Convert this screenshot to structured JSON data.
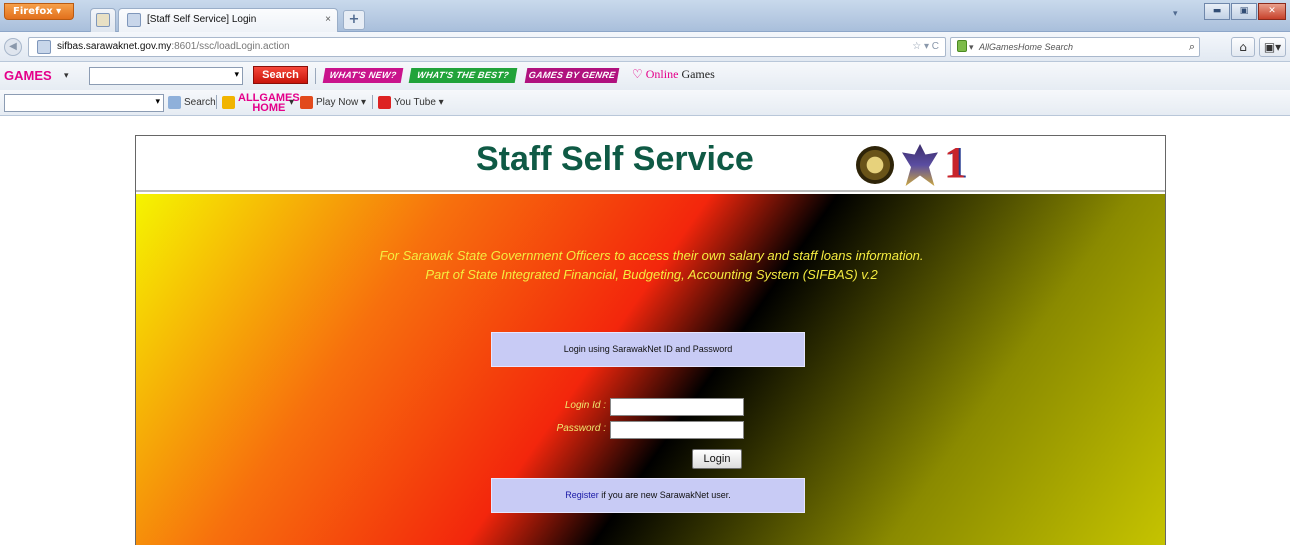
{
  "browser": {
    "menu_button": "Firefox",
    "tab_title": "[Staff Self Service] Login",
    "tab_close": "×",
    "new_tab": "+",
    "url_host": "sifbas.sarawaknet.gov.my",
    "url_rest": ":8601/ssc/loadLogin.action",
    "search_placeholder": "AllGamesHome Search"
  },
  "games_toolbar": {
    "logo": "GAMES",
    "search_button": "Search",
    "whats_new": "WHAT'S NEW?",
    "whats_best": "WHAT'S THE BEST?",
    "games_by_genre": "GAMES BY GENRE",
    "online_prefix": "Online",
    "online_suffix": " Games"
  },
  "toolbar2": {
    "search_label": "Search",
    "allgames_top": "ALLGAMES",
    "allgames_bottom": "HOME",
    "play_now": "Play Now",
    "youtube": "You Tube"
  },
  "page": {
    "title": "Staff Self Service",
    "emblem_text": "1",
    "intro_line1": "For Sarawak State Government Officers to access their own salary and staff loans information.",
    "intro_line2": "Part of State Integrated Financial, Budgeting, Accounting System (SIFBAS) v.2",
    "login_heading": "Login using SarawakNet ID and Password",
    "login_id_label": "Login Id :",
    "password_label": "Password :",
    "login_button": "Login",
    "register_link": "Register",
    "register_text": " if you are new SarawakNet user."
  },
  "colors": {
    "title_green": "#0f5a45",
    "intro_yellow": "#f5ed40",
    "box_lavender": "#c8cbf5",
    "games_pink": "#e4008a"
  }
}
